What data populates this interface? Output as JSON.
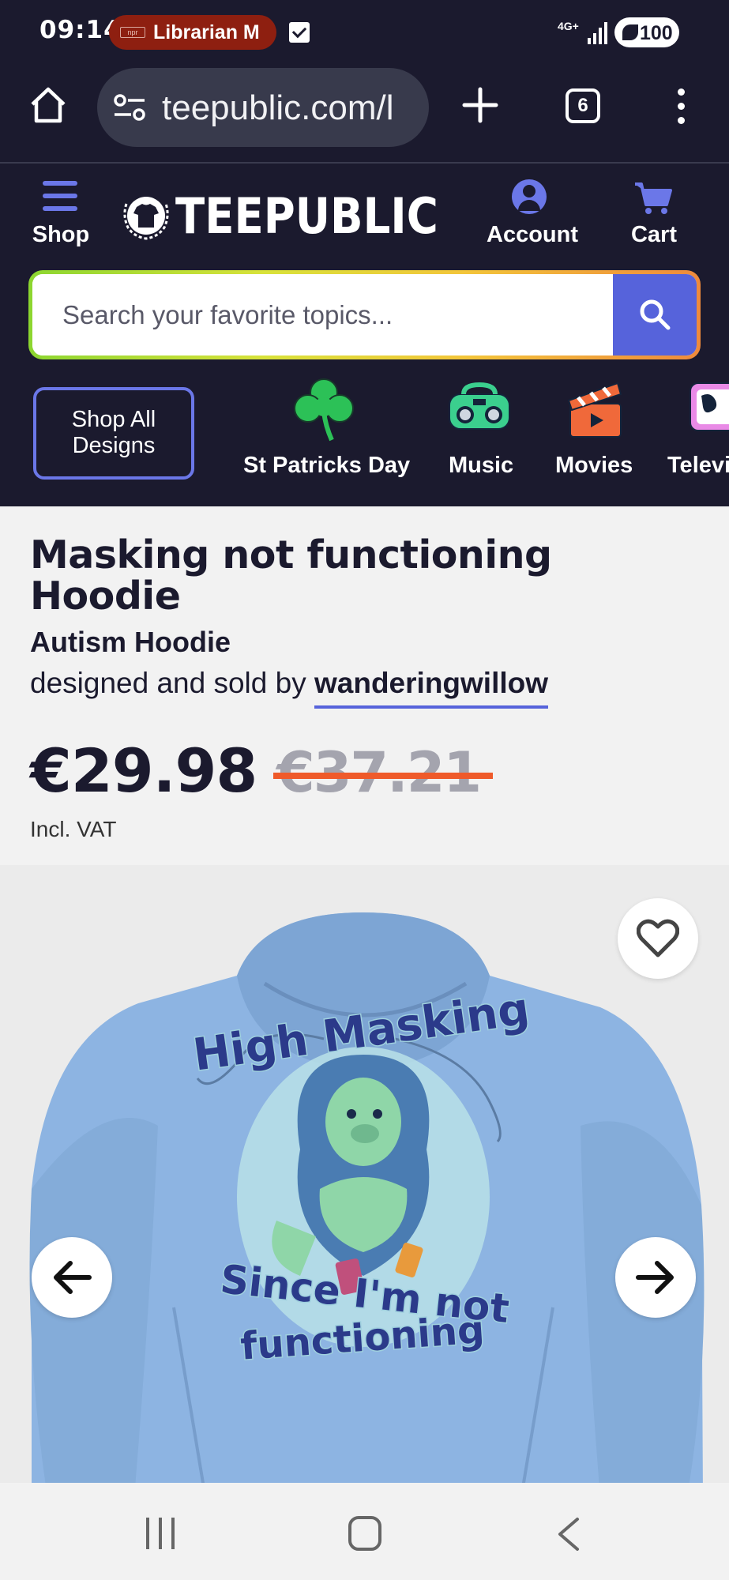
{
  "status_bar": {
    "time": "09:14",
    "notification_app": "npr",
    "notification_text": "Librarian M",
    "network": "4G+",
    "battery": "100"
  },
  "browser": {
    "url": "teepublic.com/l",
    "tab_count": "6"
  },
  "site_header": {
    "shop_label": "Shop",
    "logo_text": "TEEPUBLIC",
    "account_label": "Account",
    "cart_label": "Cart",
    "search_placeholder": "Search your favorite topics...",
    "shop_all_line1": "Shop All",
    "shop_all_line2": "Designs",
    "categories": [
      {
        "label": "St Patricks Day",
        "icon": "shamrock-icon"
      },
      {
        "label": "Music",
        "icon": "boombox-icon"
      },
      {
        "label": "Movies",
        "icon": "clapperboard-icon"
      },
      {
        "label": "Televi",
        "icon": "tv-icon"
      }
    ]
  },
  "product": {
    "title": "Masking not functioning Hoodie",
    "subtitle": "Autism Hoodie",
    "designed_by_prefix": "designed and sold by",
    "designer": "wanderingwillow",
    "price": "€29.98",
    "old_price": "€37.21",
    "vat_note": "Incl. VAT"
  },
  "gallery": {
    "print_line1": "High Masking",
    "print_line2": "Since I'm not",
    "print_line3": "functioning",
    "hoodie_color": "#8db4e2"
  },
  "colors": {
    "brand_dark": "#1b1a2e",
    "accent": "#5663db",
    "sale": "#ef5a2a"
  }
}
